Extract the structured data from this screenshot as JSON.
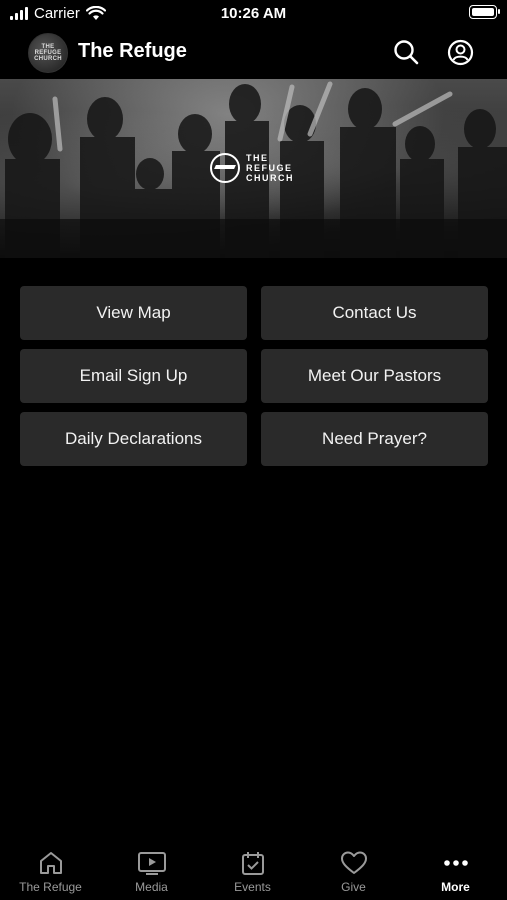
{
  "status_bar": {
    "carrier": "Carrier",
    "time": "10:26 AM"
  },
  "header": {
    "title": "The Refuge",
    "logo_text": "THE REFUGE CHURCH"
  },
  "hero": {
    "logo_line1": "THE",
    "logo_line2": "REFUGE",
    "logo_line3": "CHURCH"
  },
  "buttons": [
    {
      "label": "View Map"
    },
    {
      "label": "Contact Us"
    },
    {
      "label": "Email Sign Up"
    },
    {
      "label": "Meet Our Pastors"
    },
    {
      "label": "Daily Declarations"
    },
    {
      "label": "Need Prayer?"
    }
  ],
  "tabs": [
    {
      "label": "The Refuge",
      "icon": "home-icon"
    },
    {
      "label": "Media",
      "icon": "play-icon"
    },
    {
      "label": "Events",
      "icon": "calendar-icon"
    },
    {
      "label": "Give",
      "icon": "heart-icon"
    },
    {
      "label": "More",
      "icon": "more-icon",
      "active": true
    }
  ],
  "colors": {
    "background": "#000000",
    "button": "#2a2a2a",
    "text": "#ffffff",
    "inactive_tab": "#9a9a9a"
  }
}
